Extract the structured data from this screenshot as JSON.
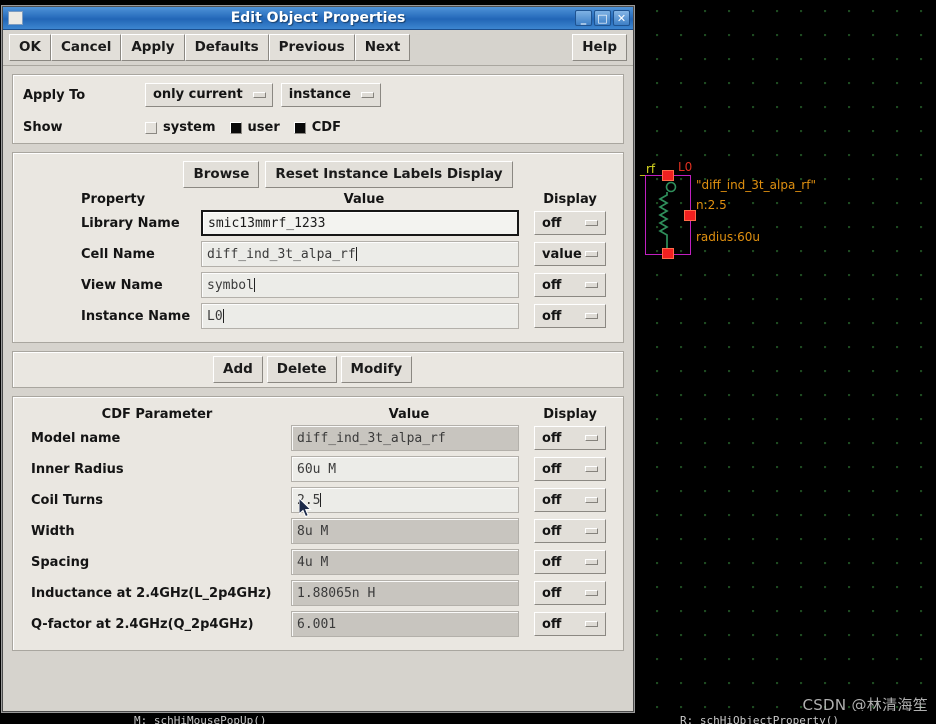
{
  "window": {
    "title": "Edit Object Properties",
    "icon": "window-menu-icon",
    "minimize": "_",
    "maximize": "□",
    "close": "✕"
  },
  "toolbar": {
    "ok": "OK",
    "cancel": "Cancel",
    "apply": "Apply",
    "defaults": "Defaults",
    "previous": "Previous",
    "next": "Next",
    "help": "Help"
  },
  "apply_section": {
    "apply_to_label": "Apply To",
    "scope_option": "only current",
    "target_option": "instance",
    "show_label": "Show",
    "checkboxes": [
      {
        "label": "system",
        "checked": false
      },
      {
        "label": "user",
        "checked": true
      },
      {
        "label": "CDF",
        "checked": true
      }
    ]
  },
  "property_section": {
    "browse_button": "Browse",
    "reset_button": "Reset Instance Labels Display",
    "headers": {
      "property": "Property",
      "value": "Value",
      "display": "Display"
    },
    "rows": [
      {
        "label": "Library Name",
        "value": "smic13mmrf_1233",
        "display": "off",
        "focused": true,
        "readonly": false
      },
      {
        "label": "Cell Name",
        "value": "diff_ind_3t_alpa_rf",
        "display": "value",
        "focused": false,
        "readonly": false
      },
      {
        "label": "View Name",
        "value": "symbol",
        "display": "off",
        "focused": false,
        "readonly": false
      },
      {
        "label": "Instance Name",
        "value": "L0",
        "display": "off",
        "focused": false,
        "readonly": false
      }
    ]
  },
  "edit_strip": {
    "add": "Add",
    "delete": "Delete",
    "modify": "Modify"
  },
  "cdf_section": {
    "headers": {
      "parameter": "CDF Parameter",
      "value": "Value",
      "display": "Display"
    },
    "rows": [
      {
        "label": "Model name",
        "value": "diff_ind_3t_alpa_rf",
        "display": "off",
        "readonly": true
      },
      {
        "label": "Inner Radius",
        "value": "60u M",
        "display": "off",
        "readonly": false
      },
      {
        "label": "Coil Turns",
        "value": "2.5",
        "display": "off",
        "readonly": false
      },
      {
        "label": "Width",
        "value": "8u M",
        "display": "off",
        "readonly": true
      },
      {
        "label": "Spacing",
        "value": "4u M",
        "display": "off",
        "readonly": true
      },
      {
        "label": "Inductance at 2.4GHz(L_2p4GHz)",
        "value": "1.88065n H",
        "display": "off",
        "readonly": true
      },
      {
        "label": "Q-factor at 2.4GHz(Q_2p4GHz)",
        "value": "6.001",
        "display": "off",
        "readonly": true
      }
    ]
  },
  "schematic": {
    "net_label": "_rf",
    "instance_label": "L0",
    "cell_label": "\"diff_ind_3t_alpa_rf\"",
    "turns_label": "n:2.5",
    "radius_label": "radius:60u",
    "colors": {
      "outline": "#c020c0",
      "coil": "#2f8f5b",
      "pin": "#f02020",
      "text": "#e09010",
      "instance_text": "#e03020",
      "net_text": "#d8d820",
      "grid": "#1d4a20",
      "background": "#000000"
    }
  },
  "statusbar": {
    "left": "M: schHiMousePopUp()",
    "right": "R: schHiObjectProperty()"
  },
  "watermark": "CSDN @林清海笙"
}
